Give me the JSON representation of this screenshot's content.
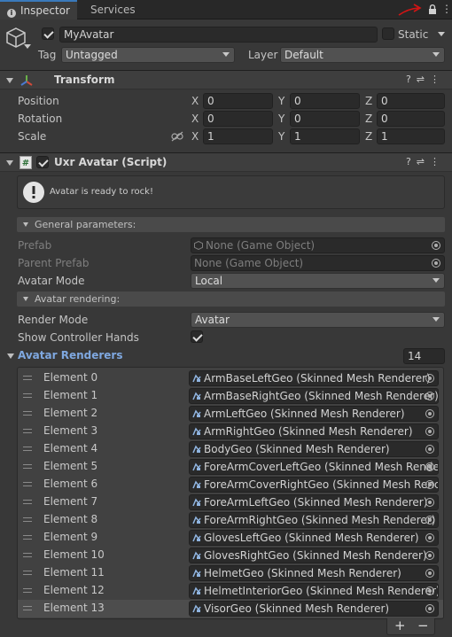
{
  "tabs": [
    {
      "label": "Inspector"
    },
    {
      "label": "Services"
    }
  ],
  "object": {
    "name": "MyAvatar",
    "enabled": true,
    "static_label": "Static",
    "tag_label": "Tag",
    "tag_value": "Untagged",
    "layer_label": "Layer",
    "layer_value": "Default"
  },
  "transform": {
    "title": "Transform",
    "rows": [
      {
        "label": "Position",
        "x": "0",
        "y": "0",
        "z": "0"
      },
      {
        "label": "Rotation",
        "x": "0",
        "y": "0",
        "z": "0"
      },
      {
        "label": "Scale",
        "x": "1",
        "y": "1",
        "z": "1"
      }
    ],
    "axis_x": "X",
    "axis_y": "Y",
    "axis_z": "Z"
  },
  "script": {
    "title": "Uxr Avatar (Script)",
    "help_message": "Avatar is ready to rock!",
    "general_section": "General parameters:",
    "prefab_label": "Prefab",
    "prefab_value": "None (Game Object)",
    "parent_prefab_label": "Parent Prefab",
    "parent_prefab_value": "None (Game Object)",
    "avatar_mode_label": "Avatar Mode",
    "avatar_mode_value": "Local",
    "rendering_section": "Avatar rendering:",
    "render_mode_label": "Render Mode",
    "render_mode_value": "Avatar",
    "show_hands_label": "Show Controller Hands",
    "show_hands_value": true,
    "renderers_label": "Avatar Renderers",
    "renderers_count": "14",
    "elements": [
      {
        "label": "Element 0",
        "value": "ArmBaseLeftGeo (Skinned Mesh Renderer)"
      },
      {
        "label": "Element 1",
        "value": "ArmBaseRightGeo (Skinned Mesh Renderer)"
      },
      {
        "label": "Element 2",
        "value": "ArmLeftGeo (Skinned Mesh Renderer)"
      },
      {
        "label": "Element 3",
        "value": "ArmRightGeo (Skinned Mesh Renderer)"
      },
      {
        "label": "Element 4",
        "value": "BodyGeo (Skinned Mesh Renderer)"
      },
      {
        "label": "Element 5",
        "value": "ForeArmCoverLeftGeo (Skinned Mesh Rende"
      },
      {
        "label": "Element 6",
        "value": "ForeArmCoverRightGeo (Skinned Mesh Renc"
      },
      {
        "label": "Element 7",
        "value": "ForeArmLeftGeo (Skinned Mesh Renderer)"
      },
      {
        "label": "Element 8",
        "value": "ForeArmRightGeo (Skinned Mesh Renderer)"
      },
      {
        "label": "Element 9",
        "value": "GlovesLeftGeo (Skinned Mesh Renderer)"
      },
      {
        "label": "Element 10",
        "value": "GlovesRightGeo (Skinned Mesh Renderer)"
      },
      {
        "label": "Element 11",
        "value": "HelmetGeo (Skinned Mesh Renderer)"
      },
      {
        "label": "Element 12",
        "value": "HelmetInteriorGeo (Skinned Mesh Renderer)"
      },
      {
        "label": "Element 13",
        "value": "VisorGeo (Skinned Mesh Renderer)"
      }
    ],
    "add_symbol": "+",
    "remove_symbol": "−"
  },
  "colors": {
    "accent": "#3a79bb",
    "renderers_label": "#7fa8e0",
    "annotation_arrow": "#d41414"
  }
}
